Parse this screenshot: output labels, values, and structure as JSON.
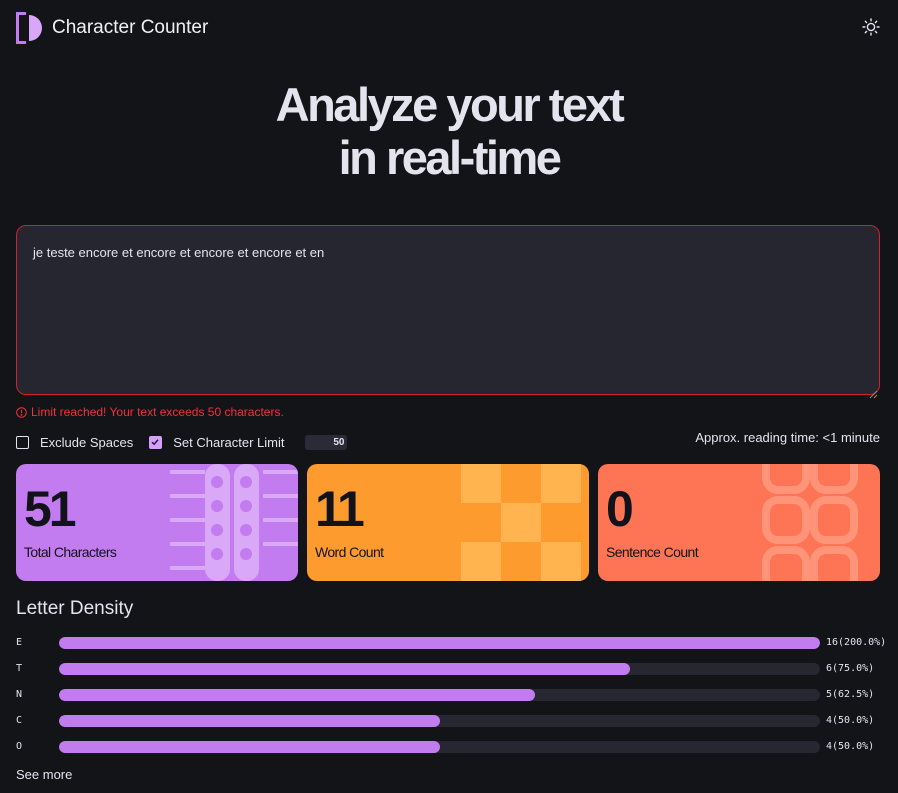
{
  "header": {
    "title": "Character Counter",
    "logo_icon": "half-circle-logo-icon",
    "theme_icon": "sun-icon"
  },
  "hero": {
    "line1": "Analyze your text",
    "line2": "in real-time"
  },
  "editor": {
    "value": "je teste encore et encore et encore et encore et en",
    "border_color": "#d3202a"
  },
  "warning": {
    "icon": "info-circle-icon",
    "message": "Limit reached! Your text exceeds 50 characters.",
    "color": "#f4303b"
  },
  "options": {
    "exclude_spaces_label": "Exclude Spaces",
    "exclude_spaces_checked": false,
    "char_limit_label": "Set Character Limit",
    "char_limit_checked": true,
    "char_limit_value": "50",
    "reading_time": "Approx. reading time: <1 minute"
  },
  "stats": [
    {
      "value": "51",
      "label": "Total Characters",
      "color": "#c27cf0"
    },
    {
      "value": "11",
      "label": "Word Count",
      "color": "#fe9b2f"
    },
    {
      "value": "0",
      "label": "Sentence Count",
      "color": "#fe7555"
    }
  ],
  "density": {
    "title": "Letter Density",
    "rows": [
      {
        "letter": "E",
        "count_label": "16(200.0%)",
        "fill_percent": 100
      },
      {
        "letter": "T",
        "count_label": "6(75.0%)",
        "fill_percent": 75
      },
      {
        "letter": "N",
        "count_label": "5(62.5%)",
        "fill_percent": 62.5
      },
      {
        "letter": "C",
        "count_label": "4(50.0%)",
        "fill_percent": 50
      },
      {
        "letter": "O",
        "count_label": "4(50.0%)",
        "fill_percent": 50
      }
    ],
    "bar_color": "#c27cf0",
    "see_more": "See more"
  }
}
